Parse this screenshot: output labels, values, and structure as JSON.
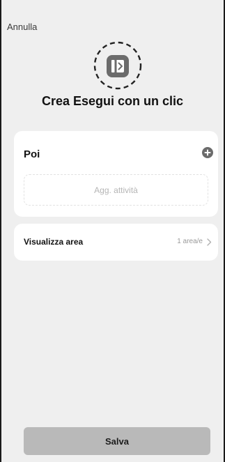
{
  "header": {
    "cancel_label": "Annulla",
    "icon_name": "tap-to-run-icon",
    "title": "Crea Esegui con un clic"
  },
  "then_section": {
    "label": "Poi",
    "add_icon": "plus-circle-icon",
    "add_task_label": "Agg. attività"
  },
  "area_section": {
    "label": "Visualizza area",
    "value": "1 area/e",
    "chevron_icon": "chevron-right-icon"
  },
  "footer": {
    "save_label": "Salva"
  },
  "colors": {
    "background": "#efefef",
    "card": "#ffffff",
    "save_button": "#b9b9b9",
    "icon_fill": "#6b6b6b"
  }
}
